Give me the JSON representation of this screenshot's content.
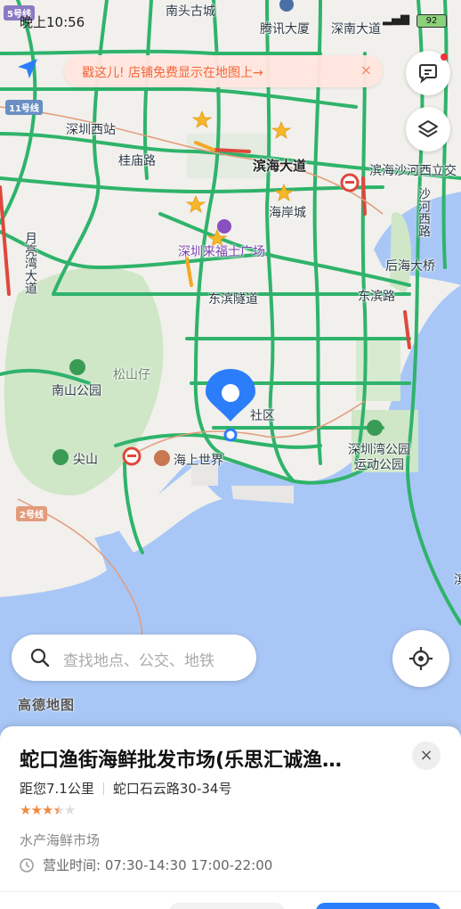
{
  "status_bar": {
    "time": "晚上10:56",
    "battery": "92"
  },
  "banner": {
    "text": "戳这儿! 店铺免费显示在地图上→",
    "close": "×"
  },
  "map_labels": {
    "nantou": "南头古城",
    "tencent": "腾讯大厦",
    "shenzhen_bay_north": "深南大道",
    "shenzhen_west": "深圳西站",
    "guimiao": "桂庙路",
    "binhai": "滨海大道",
    "binhai_shahe": "滨海沙河西立交",
    "shahe_west": "沙河西路",
    "haian": "海岸城",
    "laifushi": "深圳来福士广场",
    "houhai_bridge": "后海大桥",
    "yueliang": "月亮湾大道",
    "dongbin_tunnel": "东滨隧道",
    "dongbin_road": "东滨路",
    "songshanzai": "松山仔",
    "nanshan_park": "南山公园",
    "shekou_zone": "社区",
    "jianshan": "尖山",
    "sea_world": "海上世界",
    "bay_park": "深圳湾公园运动公园",
    "cut_e": "滨"
  },
  "metro": {
    "line5": "5号线",
    "line11": "11号线",
    "line2": "2号线"
  },
  "search": {
    "placeholder": "查找地点、公交、地铁"
  },
  "brand": "高德地图",
  "poi_card": {
    "title": "蛇口渔街海鲜批发市场(乐思汇诚渔…",
    "distance": "距您7.1公里",
    "address": "蛇口石云路30-34号",
    "rating": 3.5,
    "category": "水产海鲜市场",
    "hours": "营业时间: 07:30-14:30 17:00-22:00",
    "close": "×"
  },
  "colors": {
    "road_green": "#2fb36b",
    "water": "#a9c7f6",
    "park": "#cfe6c7",
    "pin_blue": "#2b7dfa",
    "accent_orange": "#f2673a"
  },
  "icons": [
    "location-arrow-icon",
    "message-icon",
    "layers-icon",
    "search-icon",
    "locate-icon",
    "clock-icon",
    "star-icon",
    "close-icon"
  ]
}
